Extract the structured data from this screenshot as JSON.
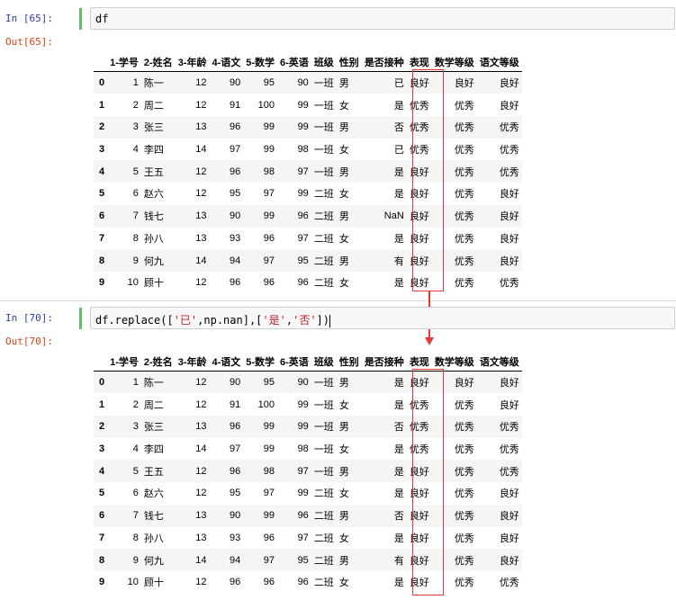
{
  "cell1": {
    "in_prompt": "In  [65]:",
    "code": "df",
    "out_prompt": "Out[65]:",
    "columns": [
      "1-学号",
      "2-姓名",
      "3-年龄",
      "4-语文",
      "5-数学",
      "6-英语",
      "班级",
      "性别",
      "是否接种",
      "表现",
      "数学等级",
      "语文等级"
    ],
    "rows": [
      [
        "0",
        "1",
        "陈一",
        "12",
        "90",
        "95",
        "90",
        "一班",
        "男",
        "已",
        "良好",
        "良好",
        "良好"
      ],
      [
        "1",
        "2",
        "周二",
        "12",
        "91",
        "100",
        "99",
        "一班",
        "女",
        "是",
        "优秀",
        "优秀",
        "良好"
      ],
      [
        "2",
        "3",
        "张三",
        "13",
        "96",
        "99",
        "99",
        "一班",
        "男",
        "否",
        "优秀",
        "优秀",
        "优秀"
      ],
      [
        "3",
        "4",
        "李四",
        "14",
        "97",
        "99",
        "98",
        "一班",
        "女",
        "已",
        "优秀",
        "优秀",
        "优秀"
      ],
      [
        "4",
        "5",
        "王五",
        "12",
        "96",
        "98",
        "97",
        "一班",
        "男",
        "是",
        "良好",
        "优秀",
        "优秀"
      ],
      [
        "5",
        "6",
        "赵六",
        "12",
        "95",
        "97",
        "99",
        "二班",
        "女",
        "是",
        "良好",
        "优秀",
        "良好"
      ],
      [
        "6",
        "7",
        "钱七",
        "13",
        "90",
        "99",
        "96",
        "二班",
        "男",
        "NaN",
        "良好",
        "优秀",
        "良好"
      ],
      [
        "7",
        "8",
        "孙八",
        "13",
        "93",
        "96",
        "97",
        "二班",
        "女",
        "是",
        "良好",
        "优秀",
        "良好"
      ],
      [
        "8",
        "9",
        "何九",
        "14",
        "94",
        "97",
        "95",
        "二班",
        "男",
        "有",
        "良好",
        "优秀",
        "良好"
      ],
      [
        "9",
        "10",
        "顾十",
        "12",
        "96",
        "96",
        "96",
        "二班",
        "女",
        "是",
        "良好",
        "优秀",
        "优秀"
      ]
    ]
  },
  "cell2": {
    "in_prompt": "In  [70]:",
    "code_parts": [
      "df.replace([",
      "'已'",
      ",np.nan],[",
      "'是'",
      ",",
      "'否'",
      "])"
    ],
    "out_prompt": "Out[70]:",
    "columns": [
      "1-学号",
      "2-姓名",
      "3-年龄",
      "4-语文",
      "5-数学",
      "6-英语",
      "班级",
      "性别",
      "是否接种",
      "表现",
      "数学等级",
      "语文等级"
    ],
    "rows": [
      [
        "0",
        "1",
        "陈一",
        "12",
        "90",
        "95",
        "90",
        "一班",
        "男",
        "是",
        "良好",
        "良好",
        "良好"
      ],
      [
        "1",
        "2",
        "周二",
        "12",
        "91",
        "100",
        "99",
        "一班",
        "女",
        "是",
        "优秀",
        "优秀",
        "良好"
      ],
      [
        "2",
        "3",
        "张三",
        "13",
        "96",
        "99",
        "99",
        "一班",
        "男",
        "否",
        "优秀",
        "优秀",
        "优秀"
      ],
      [
        "3",
        "4",
        "李四",
        "14",
        "97",
        "99",
        "98",
        "一班",
        "女",
        "是",
        "优秀",
        "优秀",
        "优秀"
      ],
      [
        "4",
        "5",
        "王五",
        "12",
        "96",
        "98",
        "97",
        "一班",
        "男",
        "是",
        "良好",
        "优秀",
        "优秀"
      ],
      [
        "5",
        "6",
        "赵六",
        "12",
        "95",
        "97",
        "99",
        "二班",
        "女",
        "是",
        "良好",
        "优秀",
        "良好"
      ],
      [
        "6",
        "7",
        "钱七",
        "13",
        "90",
        "99",
        "96",
        "二班",
        "男",
        "否",
        "良好",
        "优秀",
        "良好"
      ],
      [
        "7",
        "8",
        "孙八",
        "13",
        "93",
        "96",
        "97",
        "二班",
        "女",
        "是",
        "良好",
        "优秀",
        "良好"
      ],
      [
        "8",
        "9",
        "何九",
        "14",
        "94",
        "97",
        "95",
        "二班",
        "男",
        "有",
        "良好",
        "优秀",
        "良好"
      ],
      [
        "9",
        "10",
        "顾十",
        "12",
        "96",
        "96",
        "96",
        "二班",
        "女",
        "是",
        "良好",
        "优秀",
        "优秀"
      ]
    ]
  },
  "colors": {
    "in_prompt": "#303f9f",
    "out_prompt": "#d84315",
    "highlight": "#e53935",
    "string_literal": "#ba2121",
    "focus_bar": "#66bb6a"
  }
}
